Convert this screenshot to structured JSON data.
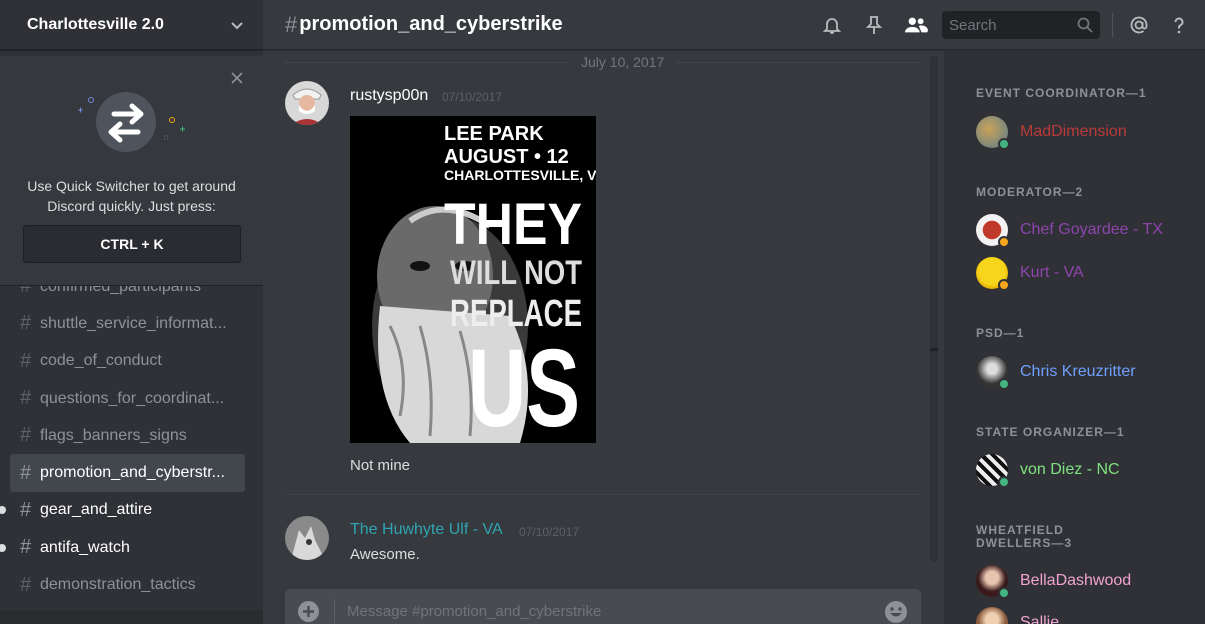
{
  "server": {
    "name": "Charlottesville 2.0"
  },
  "quick_switcher": {
    "text_line1": "Use Quick Switcher to get around",
    "text_line2": "Discord quickly. Just press:",
    "shortcut": "CTRL + K"
  },
  "channels": [
    {
      "name": "confirmed_participants",
      "state": "partial"
    },
    {
      "name": "shuttle_service_informat...",
      "state": "normal"
    },
    {
      "name": "code_of_conduct",
      "state": "normal"
    },
    {
      "name": "questions_for_coordinat...",
      "state": "normal"
    },
    {
      "name": "flags_banners_signs",
      "state": "normal"
    },
    {
      "name": "promotion_and_cyberstr...",
      "state": "active"
    },
    {
      "name": "gear_and_attire",
      "state": "unread"
    },
    {
      "name": "antifa_watch",
      "state": "unread"
    },
    {
      "name": "demonstration_tactics",
      "state": "normal"
    }
  ],
  "header": {
    "hash": "#",
    "channel_name": "promotion_and_cyberstrike",
    "search_placeholder": "Search",
    "icons": [
      "bell-icon",
      "pin-icon",
      "members-icon",
      "mention-icon",
      "help-icon"
    ]
  },
  "chat": {
    "date_divider": "July 10, 2017",
    "messages": [
      {
        "author": "rustysp00n",
        "author_color": "#ffffff",
        "timestamp": "07/10/2017",
        "poster_text": [
          "LEE PARK",
          "AUGUST • 12",
          "CHARLOTTESVILLE, VA",
          "THEY",
          "WILL NOT",
          "REPLACE",
          "US"
        ],
        "text": "Not mine"
      },
      {
        "author": "The Huwhyte Ulf - VA",
        "author_color": "#2fa4b0",
        "timestamp": "07/10/2017",
        "text": "Awesome."
      }
    ],
    "composer_placeholder": "Message #promotion_and_cyberstrike"
  },
  "members": [
    {
      "role": "EVENT COORDINATOR—1",
      "users": [
        {
          "name": "MadDimension",
          "color": "#b83a3a",
          "status": "online"
        }
      ]
    },
    {
      "role": "MODERATOR—2",
      "users": [
        {
          "name": "Chef Goyardee - TX",
          "color": "#8e44ad",
          "status": "idle"
        },
        {
          "name": "Kurt - VA",
          "color": "#8e44ad",
          "status": "idle"
        }
      ]
    },
    {
      "role": "PSD—1",
      "users": [
        {
          "name": "Chris Kreuzritter",
          "color": "#6e9fff",
          "status": "online"
        }
      ]
    },
    {
      "role": "STATE ORGANIZER—1",
      "users": [
        {
          "name": "von Diez - NC",
          "color": "#7ee37e",
          "status": "online"
        }
      ]
    },
    {
      "role_line1": "WHEATFIELD",
      "role_line2": "DWELLERS—3",
      "users": [
        {
          "name": "BellaDashwood",
          "color": "#f1a3d3",
          "status": "online"
        },
        {
          "name": "Sallie",
          "color": "#f1a3d3",
          "status": "online"
        }
      ]
    }
  ],
  "status_colors": {
    "online": "#43b581",
    "idle": "#faa61a"
  }
}
